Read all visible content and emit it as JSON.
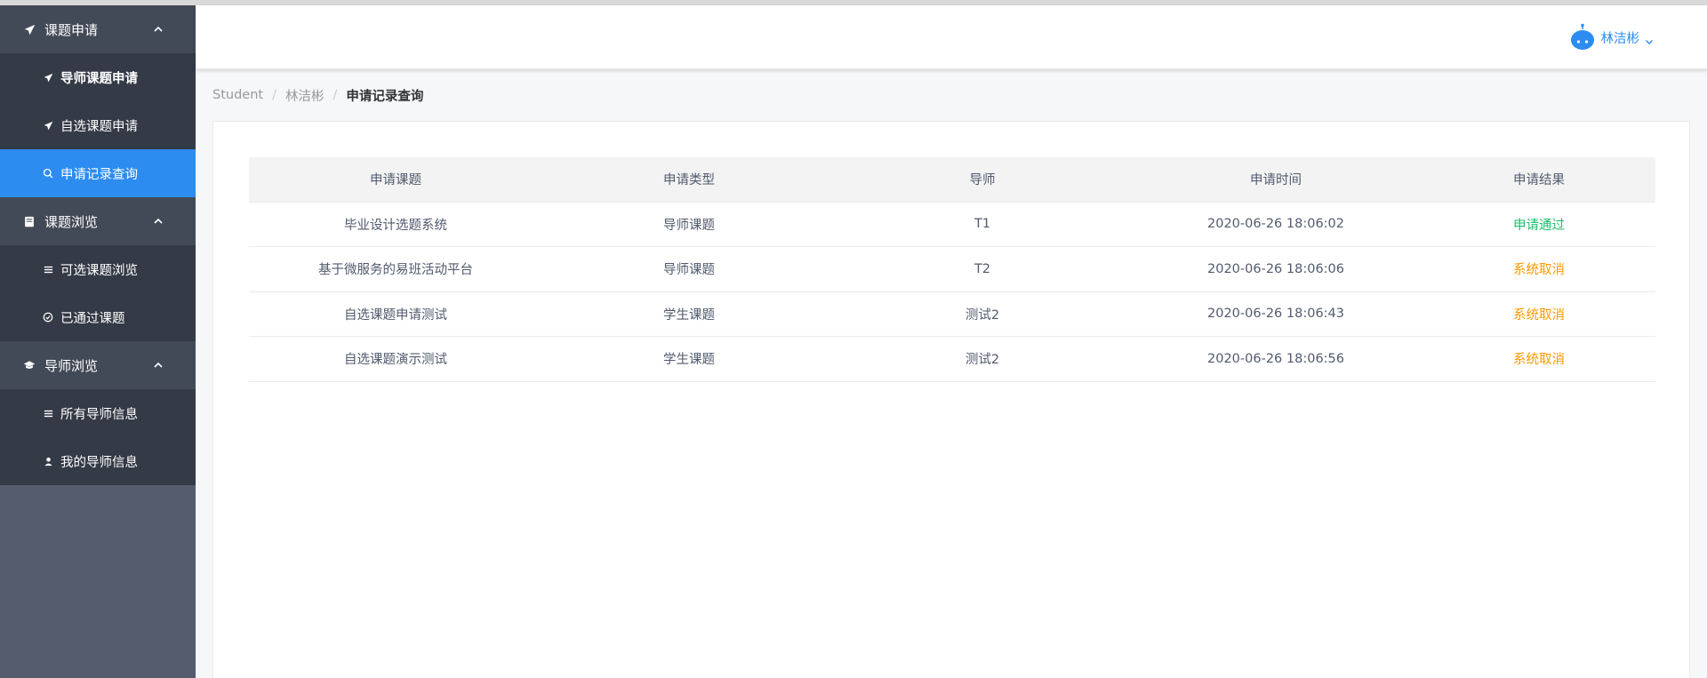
{
  "sidebar": {
    "groups": [
      {
        "title": "课题申请",
        "icon": "paper-plane-icon",
        "items": [
          {
            "label": "导师课题申请",
            "icon": "paper-plane-icon"
          },
          {
            "label": "自选课题申请",
            "icon": "paper-plane-icon"
          },
          {
            "label": "申请记录查询",
            "icon": "search-icon",
            "active": true
          }
        ]
      },
      {
        "title": "课题浏览",
        "icon": "book-icon",
        "items": [
          {
            "label": "可选课题浏览",
            "icon": "list-icon"
          },
          {
            "label": "已通过课题",
            "icon": "check-circle-icon"
          }
        ]
      },
      {
        "title": "导师浏览",
        "icon": "graduation-cap-icon",
        "items": [
          {
            "label": "所有导师信息",
            "icon": "list-icon"
          },
          {
            "label": "我的导师信息",
            "icon": "user-icon"
          }
        ]
      }
    ]
  },
  "header": {
    "user_name": "林洁彬"
  },
  "breadcrumb": {
    "items": [
      "Student",
      "林洁彬",
      "申请记录查询"
    ]
  },
  "table": {
    "columns": [
      "申请课题",
      "申请类型",
      "导师",
      "申请时间",
      "申请结果"
    ],
    "rows": [
      {
        "topic": "毕业设计选题系统",
        "type": "导师课题",
        "tutor": "T1",
        "time": "2020-06-26 18:06:02",
        "result": "申请通过"
      },
      {
        "topic": "基于微服务的易班活动平台",
        "type": "导师课题",
        "tutor": "T2",
        "time": "2020-06-26 18:06:06",
        "result": "系统取消"
      },
      {
        "topic": "自选课题申请测试",
        "type": "学生课题",
        "tutor": "测试2",
        "time": "2020-06-26 18:06:43",
        "result": "系统取消"
      },
      {
        "topic": "自选课题演示测试",
        "type": "学生课题",
        "tutor": "测试2",
        "time": "2020-06-26 18:06:56",
        "result": "系统取消"
      }
    ]
  },
  "colors": {
    "accent": "#2d8cf0",
    "success": "#19be6b",
    "warning": "#ff9900",
    "sidebar_bg": "#545c6d",
    "sidebar_group": "#434a57",
    "sidebar_item": "#343a46"
  }
}
